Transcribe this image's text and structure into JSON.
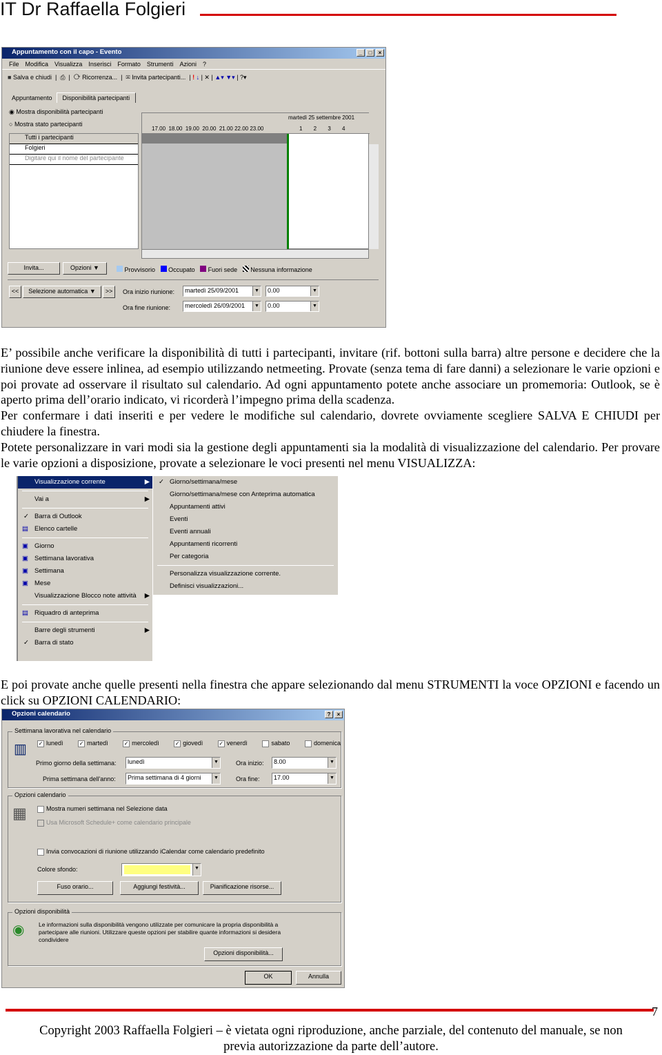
{
  "header": {
    "title": "IT Dr Raffaella Folgieri"
  },
  "shot1": {
    "title": "Appuntamento con il capo - Evento",
    "menu": [
      "File",
      "Modifica",
      "Visualizza",
      "Inserisci",
      "Formato",
      "Strumenti",
      "Azioni",
      "?"
    ],
    "toolbar": {
      "save": "Salva e chiudi",
      "recurrence": "Ricorrenza...",
      "invite": "Invita partecipanti..."
    },
    "tabs": [
      "Appuntamento",
      "Disponibilità partecipanti"
    ],
    "radio": [
      "Mostra disponibilità partecipanti",
      "Mostra stato partecipanti"
    ],
    "list": [
      "Tutti i partecipanti",
      "Folgieri",
      "Digitare qui il nome del partecipante"
    ],
    "date_header": "martedì 25 settembre 2001",
    "hours_left": "17.00  18.00  19.00  20.00  21.00 22.00 23.00",
    "hours_right": "1  2  3  4",
    "buttons": {
      "invite": "Invita...",
      "options": "Opzioni"
    },
    "legend": [
      {
        "label": "Provvisorio",
        "color": "#a6caf0"
      },
      {
        "label": "Occupato",
        "color": "#0000ff"
      },
      {
        "label": "Fuori sede",
        "color": "#800080"
      },
      {
        "label": "Nessuna informazione",
        "color": "#ffffff"
      }
    ],
    "autopick": "Selezione automatica",
    "prev": "<<",
    "next": ">>",
    "start_label": "Ora inizio riunione:",
    "end_label": "Ora fine riunione:",
    "start_date": "martedì 25/09/2001",
    "start_time": "0.00",
    "end_date": "mercoledì 26/09/2001",
    "end_time": "0.00"
  },
  "para1": [
    "E’ possibile anche verificare la disponibilità di tutti i partecipanti, invitare (rif. bottoni sulla barra) altre persone e decidere che la riunione deve essere inlinea, ad esempio utilizzando netmeeting. Provate (senza tema di fare danni) a selezionare le varie opzioni e poi provate ad osservare il risultato sul calendario. Ad ogni appuntamento potete anche associare un promemoria: Outlook, se è aperto prima dell’orario indicato, vi ricorderà l’impegno prima della scadenza.",
    "Per confermare i dati inseriti e per vedere le modifiche sul calendario, dovrete ovviamente scegliere SALVA E CHIUDI per chiudere la finestra.",
    "Potete personalizzare in vari modi sia la gestione degli appuntamenti sia la modalità di visualizzazione del calendario. Per provare le varie opzioni a disposizione, provate a selezionare le voci presenti nel menu VISUALIZZA:"
  ],
  "shot2": {
    "menu": [
      "Visualizzazione corrente",
      "Vai a",
      "Barra di Outlook",
      "Elenco cartelle",
      "Giorno",
      "Settimana lavorativa",
      "Settimana",
      "Mese",
      "Visualizzazione Blocco note attività",
      "Riquadro di anteprima",
      "Barre degli strumenti",
      "Barra di stato"
    ],
    "submenu": [
      "Giorno/settimana/mese",
      "Giorno/settimana/mese con Anteprima automatica",
      "Appuntamenti attivi",
      "Eventi",
      "Eventi annuali",
      "Appuntamenti ricorrenti",
      "Per categoria",
      "Personalizza visualizzazione corrente.",
      "Definisci visualizzazioni..."
    ]
  },
  "para2": [
    "E poi provate anche quelle presenti nella finestra che appare selezionando dal menu STRUMENTI la voce OPZIONI e facendo un click su OPZIONI CALENDARIO:"
  ],
  "shot3": {
    "title": "Opzioni calendario",
    "group1": "Settimana lavorativa nel calendario",
    "days": [
      {
        "label": "lunedì",
        "checked": true
      },
      {
        "label": "martedì",
        "checked": true
      },
      {
        "label": "mercoledì",
        "checked": true
      },
      {
        "label": "giovedì",
        "checked": true
      },
      {
        "label": "venerdì",
        "checked": true
      },
      {
        "label": "sabato",
        "checked": false
      },
      {
        "label": "domenica",
        "checked": false
      }
    ],
    "first_day_label": "Primo giorno della settimana:",
    "first_day": "lunedì",
    "first_week_label": "Prima settimana dell'anno:",
    "first_week": "Prima settimana di 4 giorni",
    "start_label": "Ora inizio:",
    "start": "8.00",
    "end_label": "Ora fine:",
    "end": "17.00",
    "group2": "Opzioni calendario",
    "opt1": "Mostra numeri settimana nel Selezione data",
    "opt2": "Usa Microsoft Schedule+ come calendario principale",
    "opt3": "Invia convocazioni di riunione utilizzando iCalendar come calendario predefinito",
    "bg_label": "Colore sfondo:",
    "bg_color": "#ffff80",
    "btn_tz": "Fuso orario...",
    "btn_hol": "Aggiungi festività...",
    "btn_res": "Pianificazione risorse...",
    "group3": "Opzioni disponibilità",
    "avail_text": "Le informazioni sulla disponibilità vengono utilizzate per comunicare la propria disponibilità a partecipare alle riunioni. Utilizzare queste opzioni per stabilire quante informazioni si desidera condividere",
    "btn_avail": "Opzioni disponibilità...",
    "ok": "OK",
    "cancel": "Annulla"
  },
  "footer": {
    "page": "7",
    "line1": "Copyright 2003 Raffaella Folgieri – è vietata ogni riproduzione, anche parziale, del contenuto del manuale, se non",
    "line2": "previa autorizzazione da parte dell’autore."
  }
}
